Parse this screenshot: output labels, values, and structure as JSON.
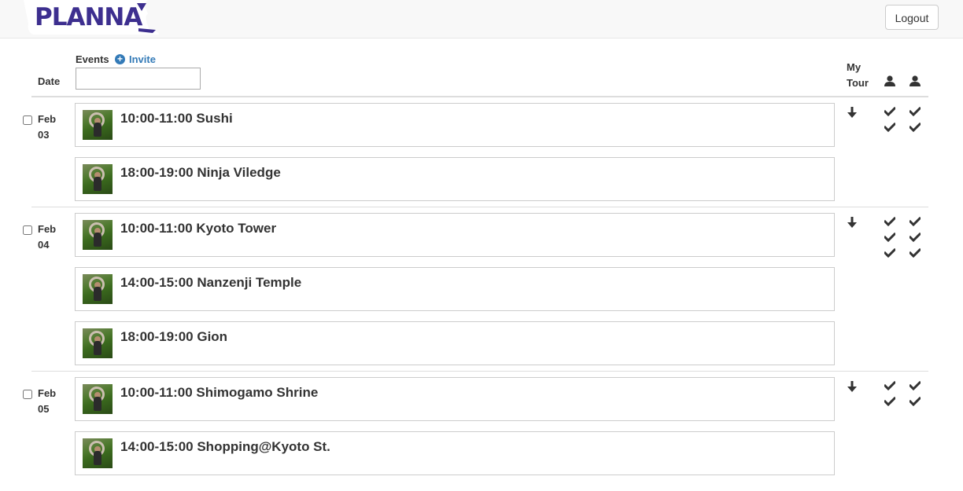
{
  "app": {
    "logo": "PLANNA",
    "logout_label": "Logout"
  },
  "header": {
    "date_label": "Date",
    "events_label": "Events",
    "invite_label": "Invite",
    "events_input_value": "",
    "my_tour_label": "My Tour"
  },
  "days": [
    {
      "month": "Feb",
      "day": "03",
      "events": [
        {
          "title": "10:00-11:00 Sushi"
        },
        {
          "title": "18:00-19:00 Ninja Viledge"
        }
      ],
      "my_tour": "arrow-down",
      "participants": [
        {
          "checks": 2
        },
        {
          "checks": 2
        }
      ]
    },
    {
      "month": "Feb",
      "day": "04",
      "events": [
        {
          "title": "10:00-11:00 Kyoto Tower"
        },
        {
          "title": "14:00-15:00 Nanzenji Temple"
        },
        {
          "title": "18:00-19:00 Gion"
        }
      ],
      "my_tour": "arrow-down",
      "participants": [
        {
          "checks": 3
        },
        {
          "checks": 3
        }
      ]
    },
    {
      "month": "Feb",
      "day": "05",
      "events": [
        {
          "title": "10:00-11:00 Shimogamo Shrine"
        },
        {
          "title": "14:00-15:00 Shopping@Kyoto St."
        }
      ],
      "my_tour": "arrow-down",
      "participants": [
        {
          "checks": 2
        },
        {
          "checks": 2
        }
      ]
    }
  ],
  "colors": {
    "brand": "#3d2f8f",
    "link": "#337ab7",
    "text": "#333333",
    "border": "#cccccc"
  }
}
